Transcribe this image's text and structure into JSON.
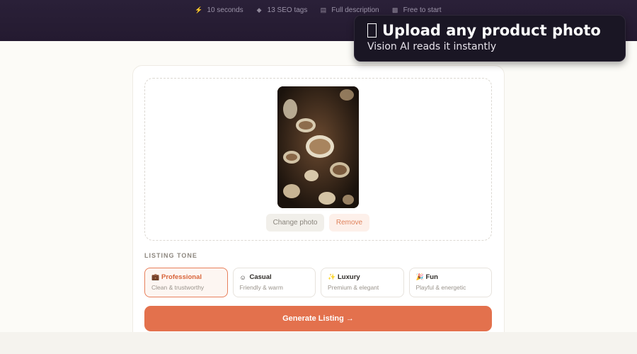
{
  "features": [
    {
      "icon": "lightning-icon",
      "glyph": "⚡",
      "label": "10 seconds"
    },
    {
      "icon": "tag-icon",
      "glyph": "◆",
      "label": "13 SEO tags"
    },
    {
      "icon": "document-icon",
      "glyph": "▤",
      "label": "Full description"
    },
    {
      "icon": "gift-icon",
      "glyph": "▩",
      "label": "Free to start"
    }
  ],
  "upload": {
    "change_label": "Change photo",
    "remove_label": "Remove"
  },
  "tone": {
    "section_label": "LISTING TONE",
    "options": [
      {
        "icon": "briefcase-icon",
        "glyph": "💼",
        "title": "Professional",
        "subtitle": "Clean & trustworthy",
        "selected": true
      },
      {
        "icon": "smile-icon",
        "glyph": "☺",
        "title": "Casual",
        "subtitle": "Friendly & warm",
        "selected": false
      },
      {
        "icon": "sparkle-icon",
        "glyph": "✨",
        "title": "Luxury",
        "subtitle": "Premium & elegant",
        "selected": false
      },
      {
        "icon": "party-icon",
        "glyph": "🎉",
        "title": "Fun",
        "subtitle": "Playful & energetic",
        "selected": false
      }
    ]
  },
  "generate_label": "Generate Listing →",
  "tooltip": {
    "title": "Upload any product photo",
    "subtitle": "Vision AI reads it instantly"
  },
  "colors": {
    "accent": "#e3714d",
    "topbar": "#241a30",
    "tooltip_bg": "#1a1624"
  }
}
